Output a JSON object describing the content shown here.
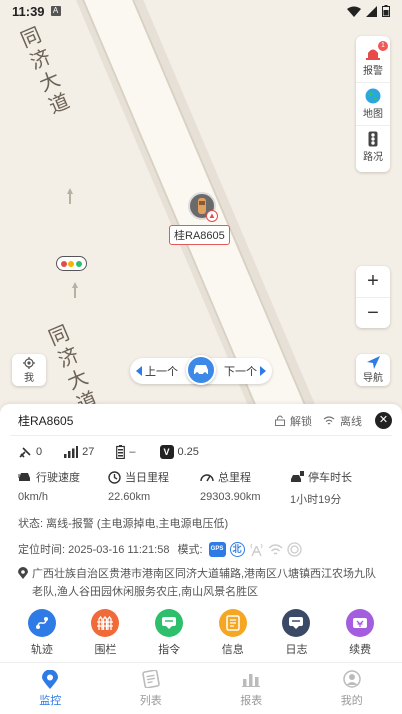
{
  "statusbar": {
    "time": "11:39",
    "notification_letter": "A"
  },
  "map": {
    "road_name_top": "同济大道",
    "road_name_bottom": "同济大道",
    "vehicle_label": "桂RA8605",
    "controls": {
      "alarm": "报警",
      "map": "地图",
      "traffic": "路况",
      "me": "我",
      "navigate": "导航"
    },
    "badge_count": "1",
    "switcher": {
      "prev": "上一个",
      "next": "下一个"
    }
  },
  "panel": {
    "plate": "桂RA8605",
    "unlock_label": "解锁",
    "offline_label": "离线",
    "stats": {
      "satellites": "0",
      "signal": "27",
      "battery": "–",
      "voltage": "0.25",
      "voltage_icon": "V"
    },
    "metrics": [
      {
        "label": "行驶速度",
        "value": "0km/h",
        "icon": "car-speed-icon"
      },
      {
        "label": "当日里程",
        "value": "22.60km",
        "icon": "clock-icon"
      },
      {
        "label": "总里程",
        "value": "29303.90km",
        "icon": "gauge-icon"
      },
      {
        "label": "停车时长",
        "value": "1小时19分",
        "icon": "parking-icon"
      }
    ],
    "status_text": "状态: 离线-报警 (主电源掉电,主电源电压低)",
    "location_time": "定位时间: 2025-03-16 11:21:58",
    "mode_label": "模式:",
    "mode_icons": {
      "gps": "GPS",
      "beidou": "北"
    },
    "address": "广西壮族自治区贵港市港南区同济大道辅路,港南区八塘镇西江农场九队老队,渔人谷田园休闲服务农庄,南山风景名胜区",
    "actions": [
      {
        "label": "轨迹",
        "color": "#2f7be6"
      },
      {
        "label": "围栏",
        "color": "#f06a3a"
      },
      {
        "label": "指令",
        "color": "#2dbf6b"
      },
      {
        "label": "信息",
        "color": "#f5a623"
      },
      {
        "label": "日志",
        "color": "#3a4a66"
      },
      {
        "label": "续费",
        "color": "#a55de0"
      }
    ]
  },
  "nav": [
    {
      "label": "监控",
      "active": true
    },
    {
      "label": "列表"
    },
    {
      "label": "报表"
    },
    {
      "label": "我的"
    }
  ]
}
